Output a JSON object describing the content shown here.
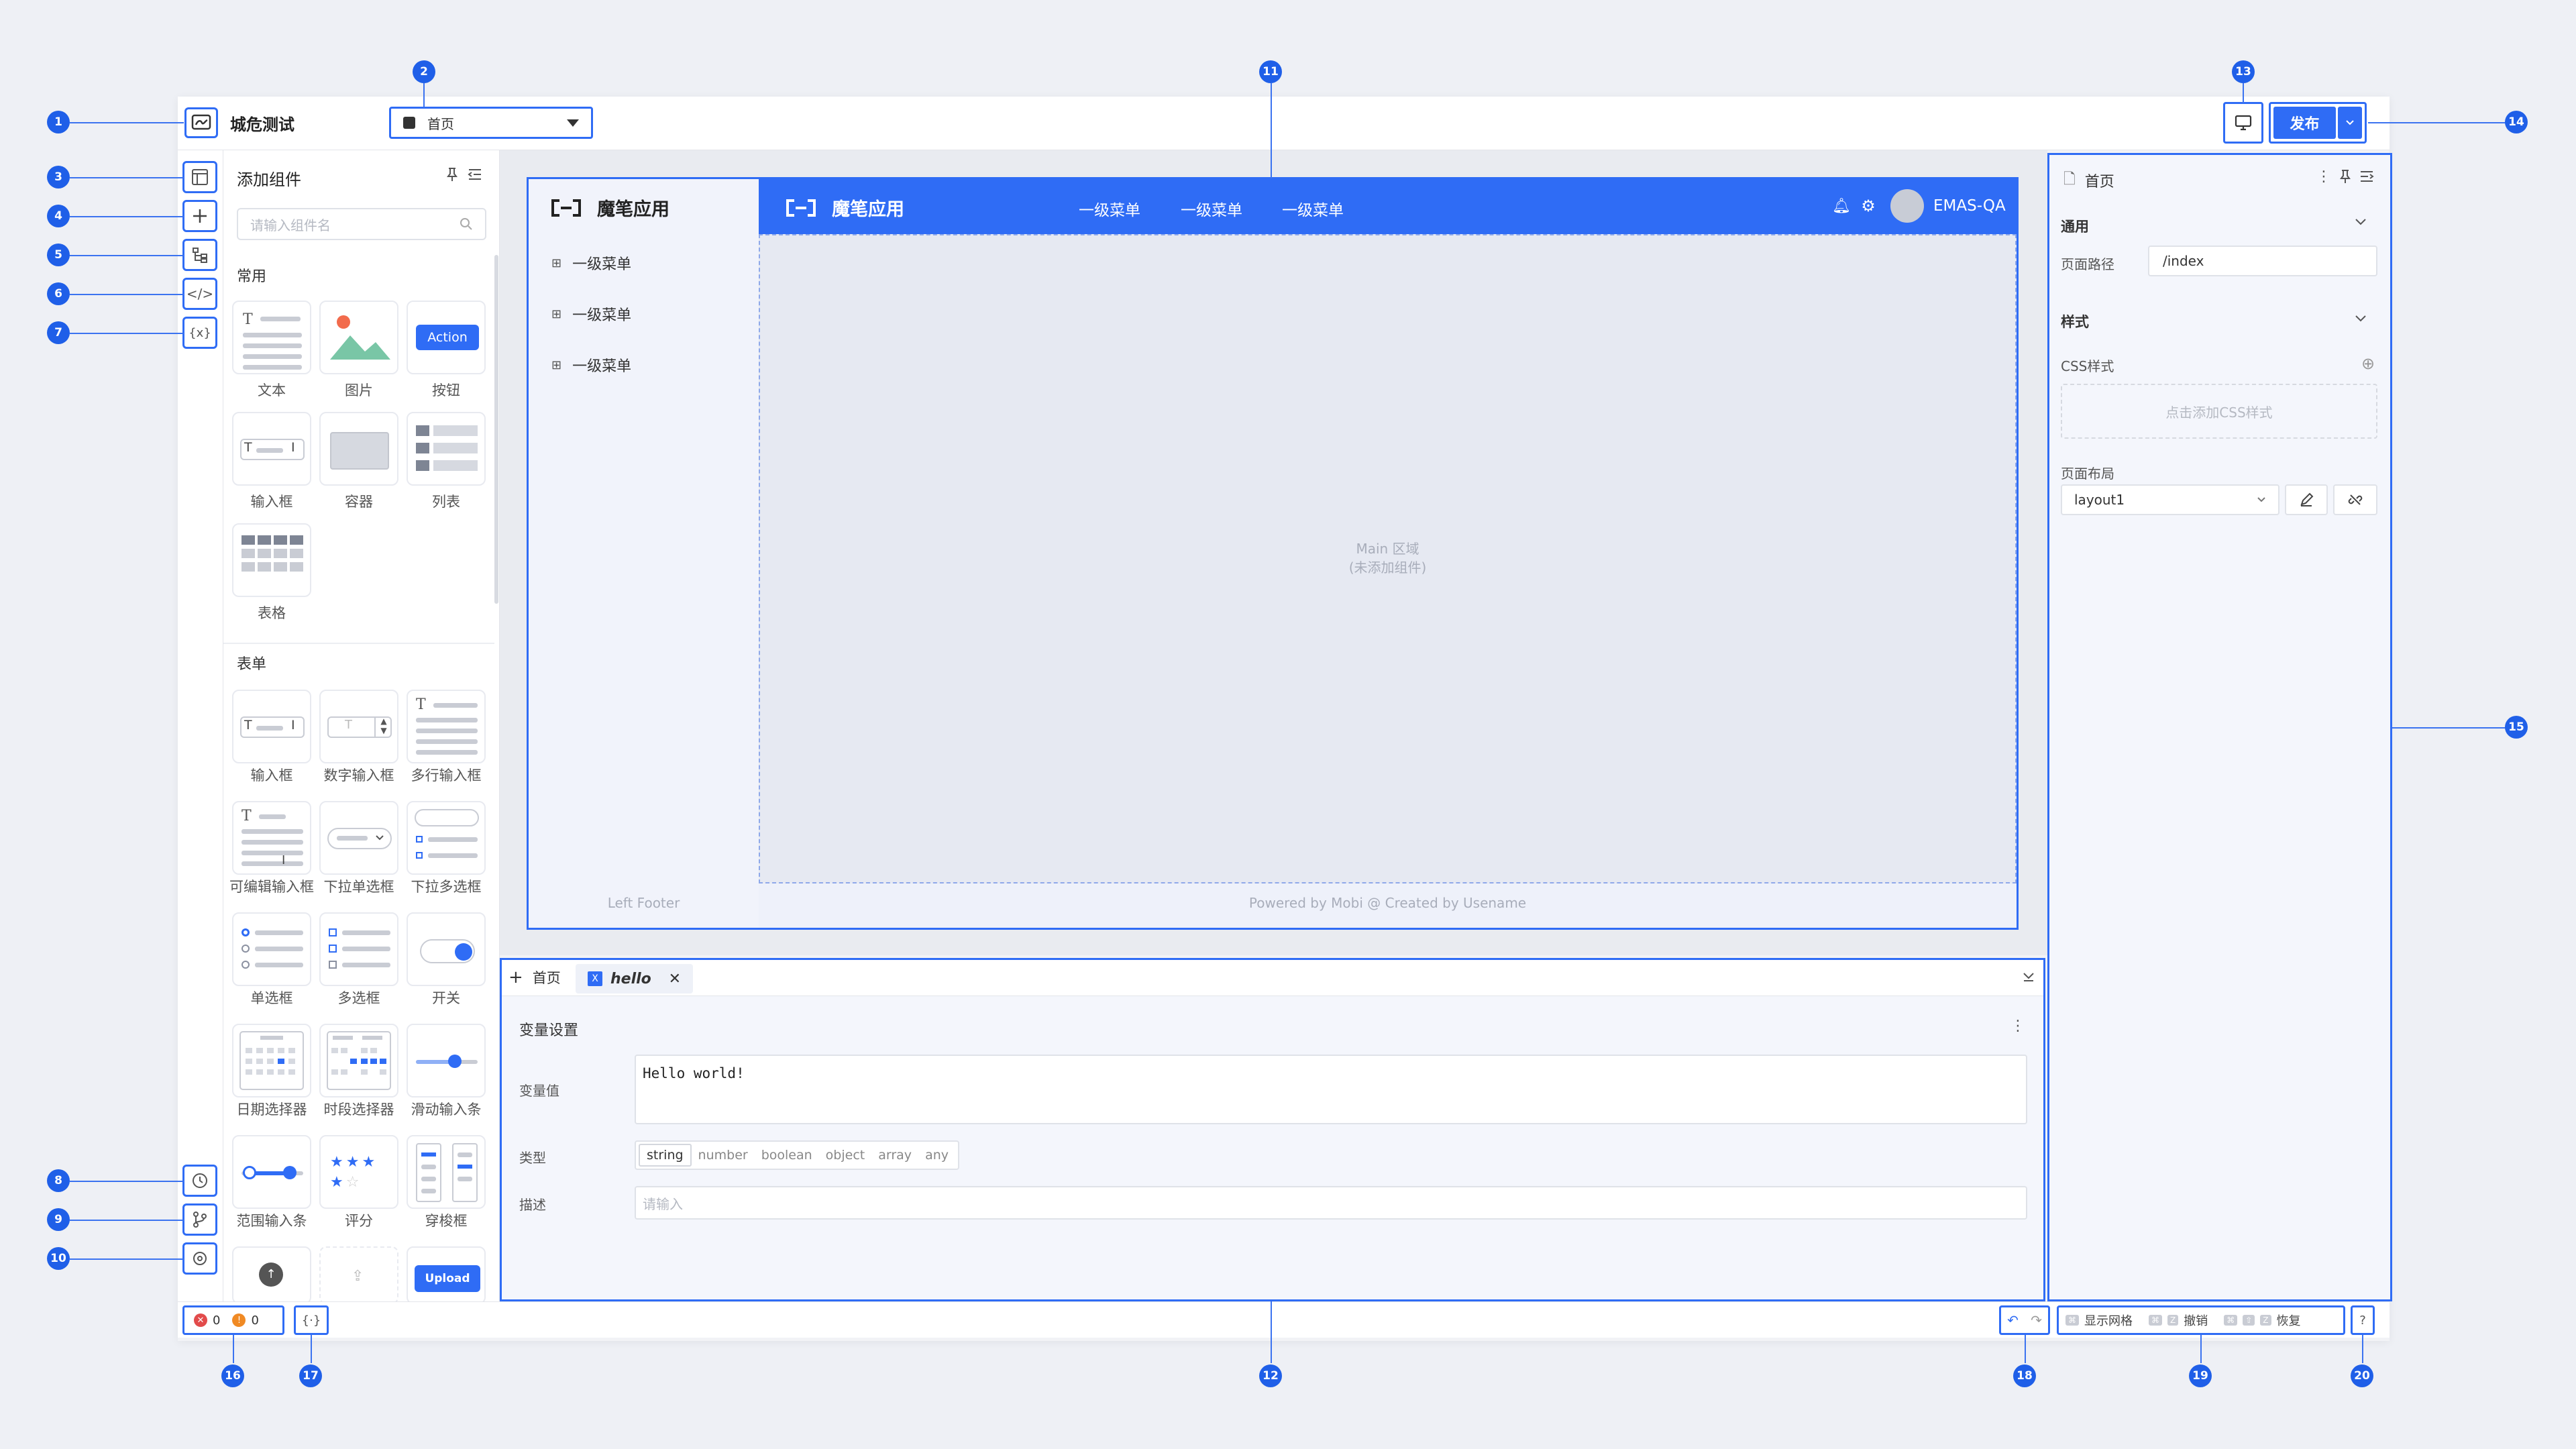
{
  "markers": [
    "1",
    "2",
    "3",
    "4",
    "5",
    "6",
    "7",
    "8",
    "9",
    "10",
    "11",
    "12",
    "13",
    "14",
    "15",
    "16",
    "17",
    "18",
    "19",
    "20"
  ],
  "topbar": {
    "app_name": "城危测试",
    "page_select": "首页",
    "publish": "发布"
  },
  "panel": {
    "title": "添加组件",
    "search_placeholder": "请输入组件名",
    "common": {
      "title": "常用",
      "items": [
        "文本",
        "图片",
        "按钮",
        "输入框",
        "容器",
        "列表",
        "表格"
      ],
      "action_label": "Action"
    },
    "form": {
      "title": "表单",
      "items": [
        "输入框",
        "数字输入框",
        "多行输入框",
        "可编辑输入框",
        "下拉单选框",
        "下拉多选框",
        "单选框",
        "多选框",
        "开关",
        "日期选择器",
        "时段选择器",
        "滑动输入条",
        "范围输入条",
        "评分",
        "穿梭框"
      ],
      "upload_label": "Upload"
    }
  },
  "canvas": {
    "brand": "魔笔应用",
    "side_menu": [
      "一级菜单",
      "一级菜单",
      "一级菜单"
    ],
    "top_menu": [
      "一级菜单",
      "一级菜单",
      "一级菜单"
    ],
    "user": "EMAS-QA",
    "main_text": "Main 区域",
    "main_sub": "(未添加组件)",
    "left_footer": "Left Footer",
    "footer": "Powered by Mobi @ Created by Usename"
  },
  "bottom": {
    "add_tab": "首页",
    "tab": "hello",
    "section": "变量设置",
    "value_label": "变量值",
    "value": "Hello world!",
    "type_label": "类型",
    "types": [
      "string",
      "number",
      "boolean",
      "object",
      "array",
      "any"
    ],
    "desc_label": "描述",
    "desc_placeholder": "请输入"
  },
  "props": {
    "title": "首页",
    "general": "通用",
    "path_label": "页面路径",
    "path_value": "/index",
    "style": "样式",
    "css_label": "CSS样式",
    "css_add": "点击添加CSS样式",
    "layout_label": "页面布局",
    "layout_value": "layout1"
  },
  "status": {
    "errors": "0",
    "warnings": "0",
    "grid": "显示网格",
    "undo": "撤销",
    "redo": "恢复"
  },
  "colors": {
    "accent": "#2f6cf5",
    "canvas_bg": "#e6e9f2"
  }
}
